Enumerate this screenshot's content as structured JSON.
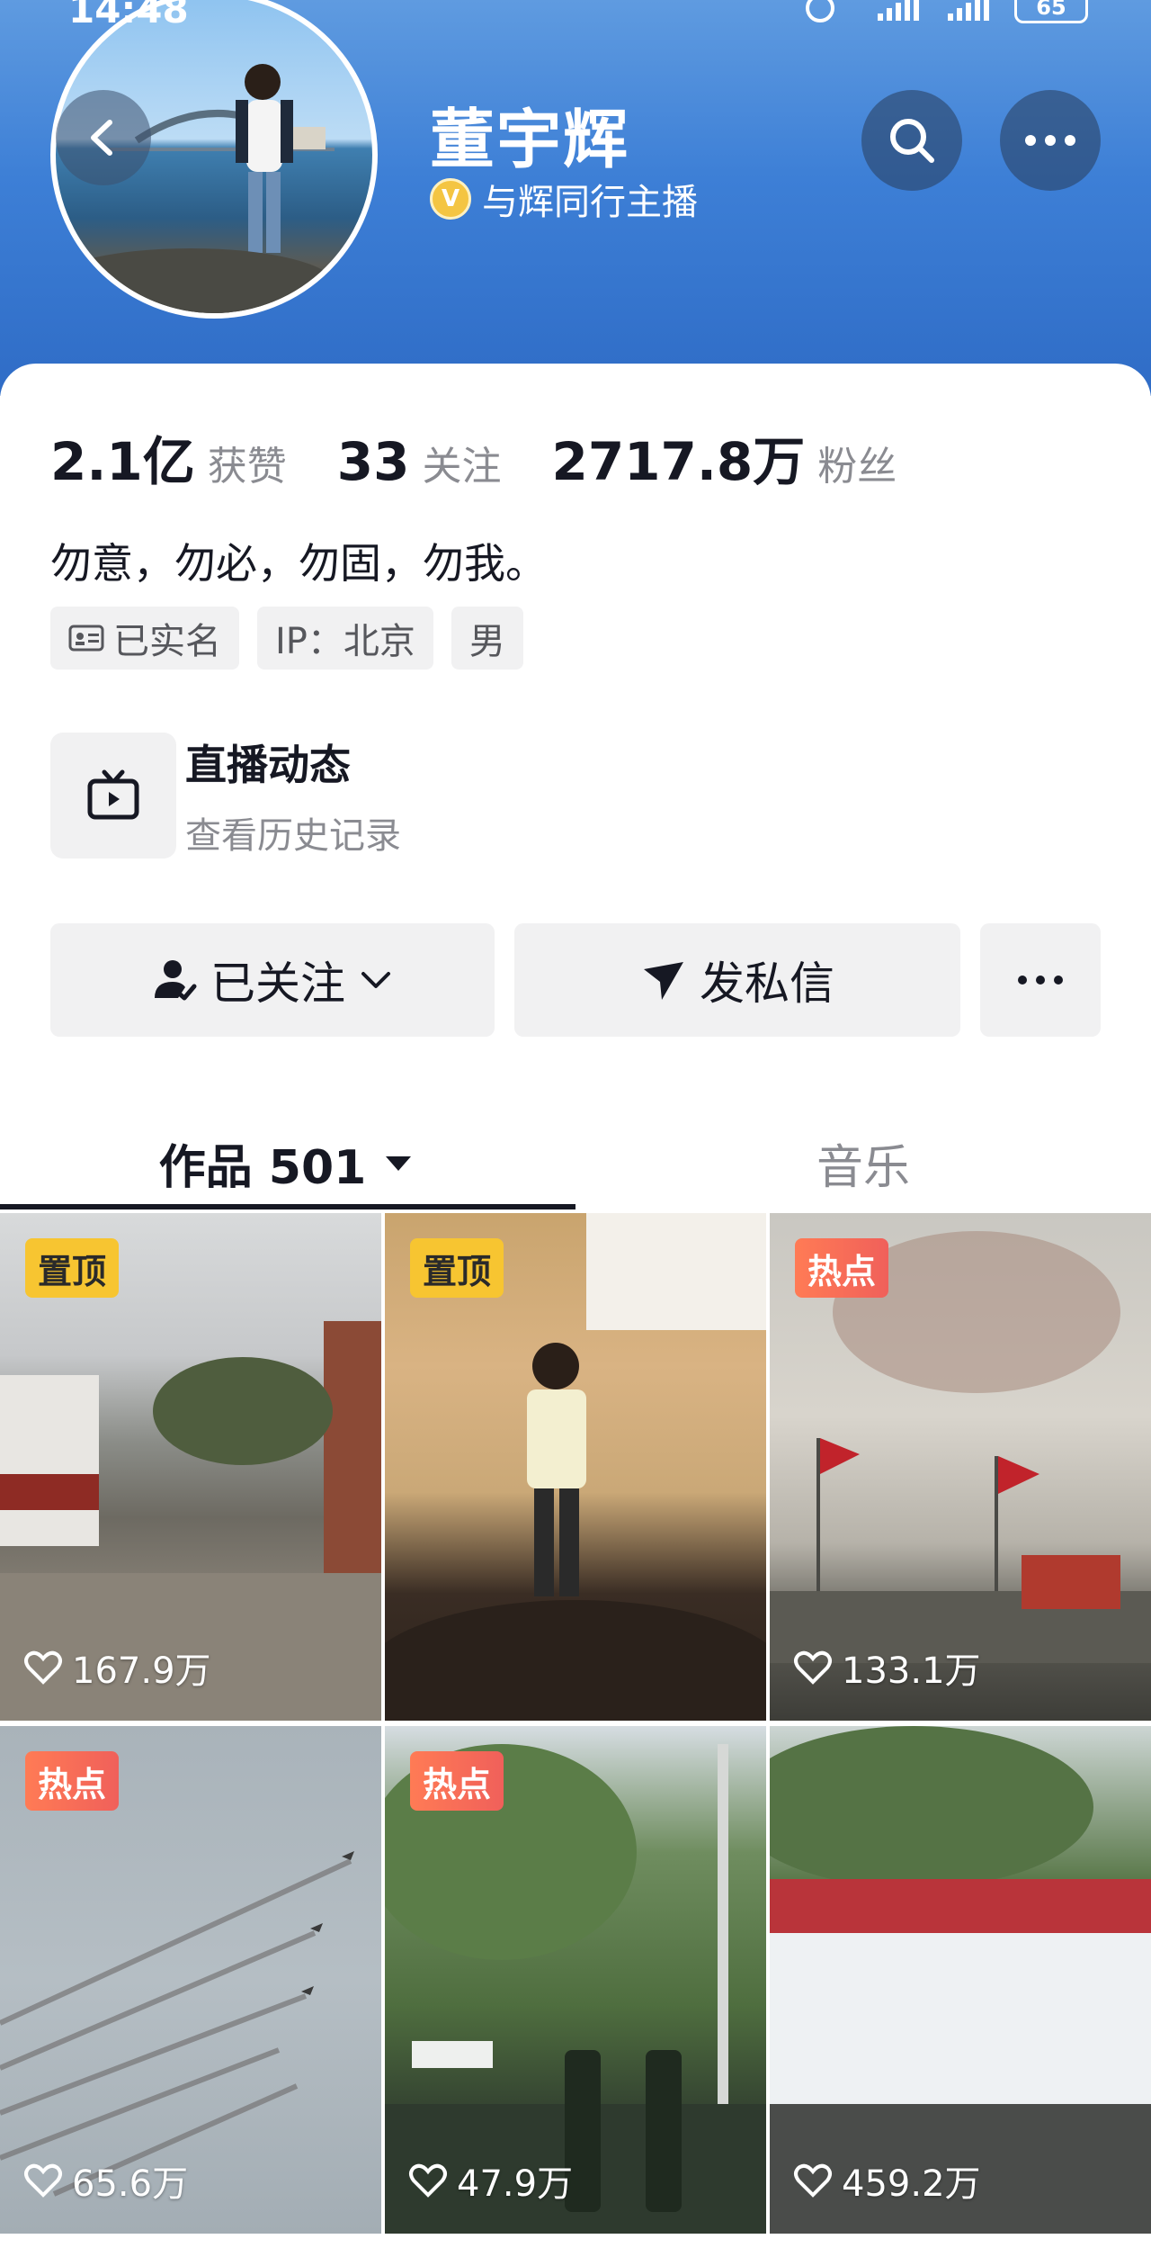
{
  "status_bar": {
    "time": "14:48",
    "battery": "65"
  },
  "profile": {
    "name": "董宇辉",
    "verify_badge": "V",
    "verify_text": "与辉同行主播",
    "stats": [
      {
        "num": "2.1亿",
        "label": "获赞"
      },
      {
        "num": "33",
        "label": "关注"
      },
      {
        "num": "2717.8万",
        "label": "粉丝"
      }
    ],
    "bio": "勿意，勿必，勿固，勿我。",
    "tags": [
      "已实名",
      "IP：北京",
      "男"
    ]
  },
  "live": {
    "title": "直播动态",
    "subtitle": "查看历史记录"
  },
  "actions": {
    "follow": "已关注",
    "message": "发私信"
  },
  "tabs": {
    "works": "作品 501",
    "music": "音乐"
  },
  "videos": [
    {
      "badge": "置顶",
      "badge_type": "pin",
      "likes": "167.9万"
    },
    {
      "badge": "置顶",
      "badge_type": "pin",
      "likes": ""
    },
    {
      "badge": "热点",
      "badge_type": "hot",
      "likes": "133.1万"
    },
    {
      "badge": "热点",
      "badge_type": "hot",
      "likes": "65.6万"
    },
    {
      "badge": "热点",
      "badge_type": "hot",
      "likes": "47.9万"
    },
    {
      "badge": "",
      "badge_type": "",
      "likes": "459.2万"
    }
  ],
  "colors": {
    "header_blue": "#3d7fd6",
    "pin_yellow": "#f7c531",
    "hot_orange": "#f0605a"
  }
}
